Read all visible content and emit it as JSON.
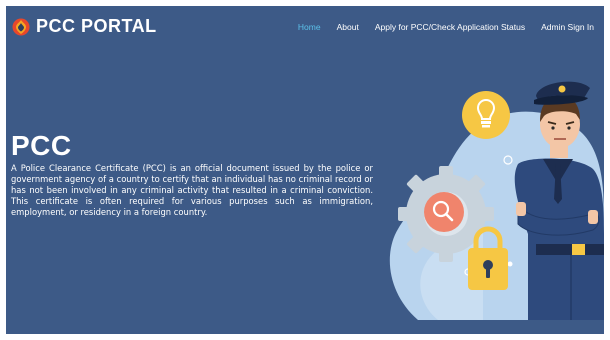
{
  "brand": {
    "name": "PCC PORTAL",
    "logo_icon": "police-badge-icon"
  },
  "nav": {
    "items": [
      {
        "label": "Home",
        "active": true
      },
      {
        "label": "About",
        "active": false
      },
      {
        "label": "Apply for PCC/Check Application Status",
        "active": false
      },
      {
        "label": "Admin Sign In",
        "active": false
      }
    ]
  },
  "hero": {
    "title": "PCC",
    "description": "A Police Clearance Certificate (PCC) is an official document issued by the police or government agency of a country to certify that an individual has no criminal record or has not been involved in any criminal activity that resulted in a criminal conviction. This certificate is often required for various purposes such as immigration, employment, or residency in a foreign country.",
    "illustration_icons": [
      "police-officer-illustration",
      "lightbulb-icon",
      "search-icon",
      "padlock-icon",
      "gear-icon"
    ]
  },
  "colors": {
    "background": "#3d5a87",
    "nav_active": "#5bc0e8",
    "text": "#ffffff",
    "accent_yellow": "#f6c744",
    "accent_coral": "#f0846c"
  }
}
